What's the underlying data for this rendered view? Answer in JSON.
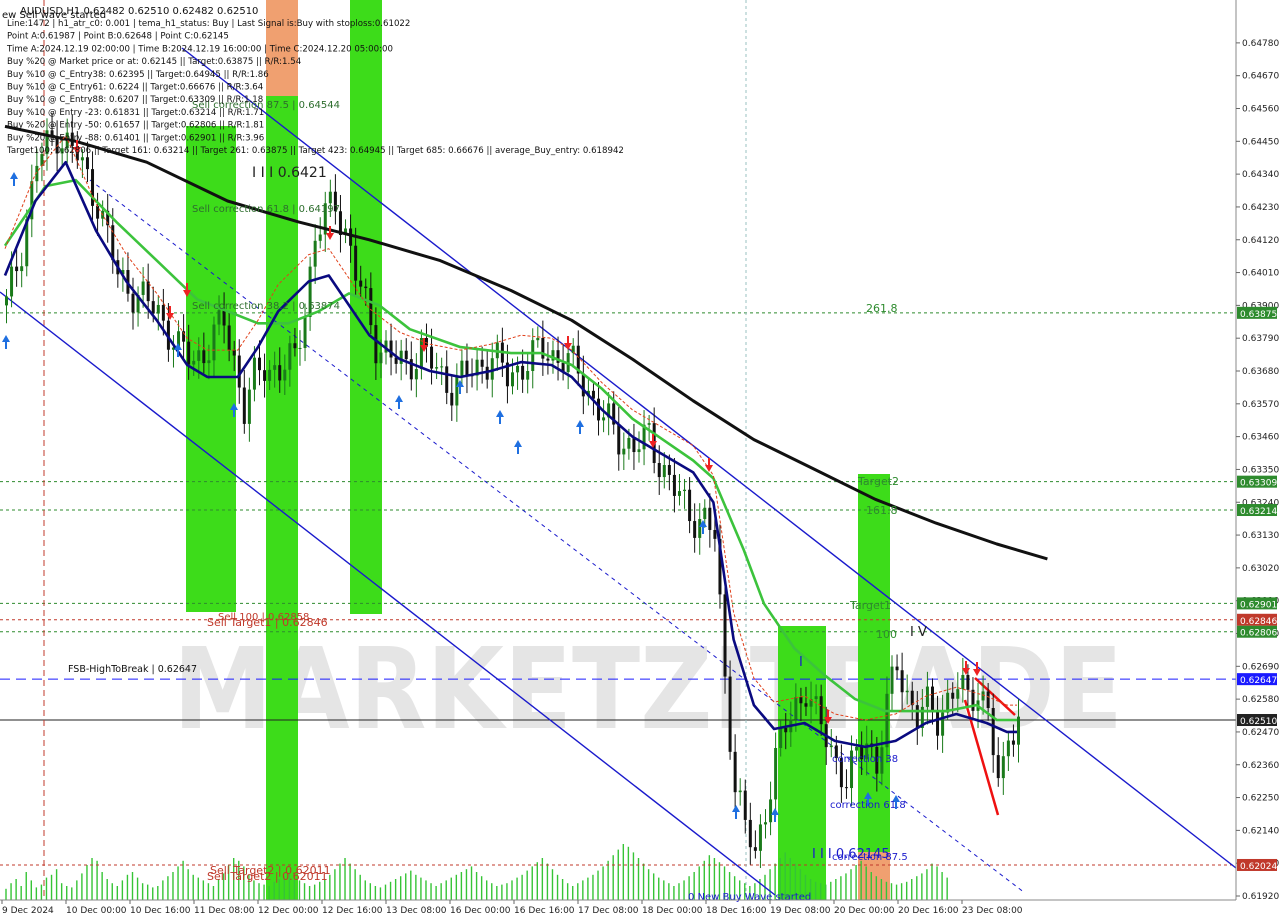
{
  "header": {
    "top_line": "AUDUSD,H1  0.62482 0.62510 0.62482 0.62510",
    "status_line": "ew Sell wave started",
    "info_lines": [
      "Line:1472  |  h1_atr_c0: 0.001  |  tema_h1_status: Buy  |  Last Signal is:Buy with stoploss:0.61022",
      "Point A:0.61987  |  Point B:0.62648  |  Point C:0.62145",
      "Time A:2024.12.19 02:00:00  |  Time B:2024.12.19 16:00:00  |  Time C:2024.12.20 05:00:00",
      "Buy %20 @ Market price or at: 0.62145  ||  Target:0.63875  ||  R/R:1.54",
      "Buy %10 @ C_Entry38: 0.62395  ||  Target:0.64945  ||  R/R:1.86",
      "Buy %10 @ C_Entry61: 0.6224  ||  Target:0.66676  ||  R/R:3.64",
      "Buy %10 @ C_Entry88: 0.6207  ||  Target:0.63309  ||  R/R:1.18",
      "Buy %10 @ Entry -23: 0.61831  ||  Target:0.63214  ||  R/R:1.71",
      "Buy %20 @ Entry -50: 0.61657  ||  Target:0.62806  ||  R/R:1.81",
      "Buy %20 @ Entry -88: 0.61401  ||  Target:0.62901  ||  R/R:3.96",
      "Target100: 0.62806  ||  Target 161: 0.63214  ||  Target 261: 0.63875  ||  Target 423: 0.64945  ||  Target 685: 0.66676  ||  average_Buy_entry: 0.618942"
    ]
  },
  "watermark": "MARKETZITRADE",
  "chart_data": {
    "type": "line",
    "title": "AUDUSD,H1",
    "ylim": [
      0.6192,
      0.6485
    ],
    "y_ticks": [
      "0.64780",
      "0.64670",
      "0.64560",
      "0.64450",
      "0.64340",
      "0.64230",
      "0.64120",
      "0.64010",
      "0.63900",
      "0.63790",
      "0.63680",
      "0.63570",
      "0.63460",
      "0.63350",
      "0.63240",
      "0.63130",
      "0.63020",
      "0.62910",
      "0.62800",
      "0.62690",
      "0.62580",
      "0.62470",
      "0.62360",
      "0.62250",
      "0.62140",
      "0.62030",
      "0.61920"
    ],
    "x_ticks": [
      "9 Dec 2024",
      "10 Dec 00:00",
      "10 Dec 16:00",
      "11 Dec 08:00",
      "12 Dec 00:00",
      "12 Dec 16:00",
      "13 Dec 08:00",
      "16 Dec 00:00",
      "16 Dec 16:00",
      "17 Dec 08:00",
      "18 Dec 00:00",
      "18 Dec 16:00",
      "19 Dec 08:00",
      "20 Dec 00:00",
      "20 Dec 16:00",
      "23 Dec 08:00"
    ],
    "close_series": {
      "name": "price",
      "points": [
        [
          0,
          0.639
        ],
        [
          3,
          0.641
        ],
        [
          6,
          0.6438
        ],
        [
          10,
          0.6448
        ],
        [
          14,
          0.644
        ],
        [
          18,
          0.6425
        ],
        [
          22,
          0.64
        ],
        [
          26,
          0.6393
        ],
        [
          30,
          0.6388
        ],
        [
          34,
          0.6375
        ],
        [
          37,
          0.6372
        ],
        [
          40,
          0.6376
        ],
        [
          43,
          0.6385
        ],
        [
          45,
          0.6372
        ],
        [
          47,
          0.6355
        ],
        [
          49,
          0.6365
        ],
        [
          51,
          0.637
        ],
        [
          54,
          0.6368
        ],
        [
          57,
          0.6372
        ],
        [
          59,
          0.639
        ],
        [
          61,
          0.6412
        ],
        [
          63,
          0.642
        ],
        [
          65,
          0.6425
        ],
        [
          67,
          0.6415
        ],
        [
          69,
          0.64
        ],
        [
          71,
          0.639
        ],
        [
          73,
          0.6378
        ],
        [
          76,
          0.6372
        ],
        [
          79,
          0.637
        ],
        [
          82,
          0.6375
        ],
        [
          85,
          0.6368
        ],
        [
          88,
          0.6363
        ],
        [
          92,
          0.6368
        ],
        [
          96,
          0.6373
        ],
        [
          99,
          0.6366
        ],
        [
          102,
          0.637
        ],
        [
          106,
          0.6375
        ],
        [
          110,
          0.6372
        ],
        [
          113,
          0.6368
        ],
        [
          116,
          0.6358
        ],
        [
          118,
          0.6352
        ],
        [
          121,
          0.6346
        ],
        [
          124,
          0.6342
        ],
        [
          127,
          0.6346
        ],
        [
          129,
          0.6338
        ],
        [
          132,
          0.6328
        ],
        [
          135,
          0.632
        ],
        [
          138,
          0.6318
        ],
        [
          140,
          0.6312
        ],
        [
          142,
          0.6265
        ],
        [
          144,
          0.623
        ],
        [
          146,
          0.6215
        ],
        [
          148,
          0.6205
        ],
        [
          150,
          0.6222
        ],
        [
          152,
          0.6238
        ],
        [
          154,
          0.6248
        ],
        [
          156,
          0.6256
        ],
        [
          158,
          0.6262
        ],
        [
          160,
          0.6252
        ],
        [
          162,
          0.6245
        ],
        [
          164,
          0.6238
        ],
        [
          166,
          0.623
        ],
        [
          168,
          0.6238
        ],
        [
          170,
          0.6245
        ],
        [
          172,
          0.6236
        ],
        [
          174,
          0.6255
        ],
        [
          176,
          0.627
        ],
        [
          178,
          0.626
        ],
        [
          180,
          0.6252
        ],
        [
          182,
          0.6255
        ],
        [
          184,
          0.6252
        ],
        [
          186,
          0.6258
        ],
        [
          188,
          0.6262
        ],
        [
          190,
          0.6258
        ],
        [
          192,
          0.6262
        ],
        [
          194,
          0.6254
        ],
        [
          196,
          0.6228
        ],
        [
          197,
          0.6234
        ],
        [
          198,
          0.6248
        ],
        [
          200,
          0.6251
        ]
      ]
    },
    "ema_green": {
      "name": "",
      "points": [
        [
          0,
          0.641
        ],
        [
          8,
          0.643
        ],
        [
          14,
          0.6432
        ],
        [
          22,
          0.6418
        ],
        [
          30,
          0.6405
        ],
        [
          38,
          0.6392
        ],
        [
          44,
          0.6388
        ],
        [
          50,
          0.6384
        ],
        [
          56,
          0.6384
        ],
        [
          62,
          0.6388
        ],
        [
          68,
          0.6394
        ],
        [
          74,
          0.639
        ],
        [
          80,
          0.6382
        ],
        [
          90,
          0.6376
        ],
        [
          100,
          0.6374
        ],
        [
          106,
          0.6374
        ],
        [
          112,
          0.637
        ],
        [
          118,
          0.6362
        ],
        [
          124,
          0.6352
        ],
        [
          130,
          0.6345
        ],
        [
          136,
          0.6338
        ],
        [
          140,
          0.6332
        ],
        [
          146,
          0.6308
        ],
        [
          150,
          0.629
        ],
        [
          156,
          0.6275
        ],
        [
          162,
          0.6266
        ],
        [
          168,
          0.6258
        ],
        [
          174,
          0.6254
        ],
        [
          180,
          0.6254
        ],
        [
          186,
          0.6254
        ],
        [
          192,
          0.6256
        ],
        [
          196,
          0.6251
        ],
        [
          200,
          0.6251
        ]
      ]
    },
    "ema_navy": {
      "name": "",
      "points": [
        [
          0,
          0.64
        ],
        [
          6,
          0.6425
        ],
        [
          12,
          0.6438
        ],
        [
          18,
          0.6415
        ],
        [
          24,
          0.6398
        ],
        [
          30,
          0.6385
        ],
        [
          36,
          0.637
        ],
        [
          40,
          0.6366
        ],
        [
          46,
          0.6366
        ],
        [
          50,
          0.6376
        ],
        [
          54,
          0.6388
        ],
        [
          60,
          0.6398
        ],
        [
          64,
          0.64
        ],
        [
          68,
          0.639
        ],
        [
          72,
          0.638
        ],
        [
          78,
          0.6372
        ],
        [
          84,
          0.6368
        ],
        [
          90,
          0.6366
        ],
        [
          96,
          0.6368
        ],
        [
          102,
          0.6371
        ],
        [
          108,
          0.637
        ],
        [
          112,
          0.6366
        ],
        [
          118,
          0.6355
        ],
        [
          124,
          0.6346
        ],
        [
          130,
          0.634
        ],
        [
          136,
          0.6334
        ],
        [
          140,
          0.6324
        ],
        [
          144,
          0.6278
        ],
        [
          148,
          0.6256
        ],
        [
          152,
          0.6248
        ],
        [
          158,
          0.625
        ],
        [
          164,
          0.6244
        ],
        [
          170,
          0.6242
        ],
        [
          176,
          0.6244
        ],
        [
          182,
          0.625
        ],
        [
          188,
          0.6253
        ],
        [
          194,
          0.625
        ],
        [
          198,
          0.6247
        ],
        [
          200,
          0.6247
        ]
      ]
    },
    "ma_black": {
      "name": "",
      "points": [
        [
          0,
          0.645
        ],
        [
          14,
          0.6445
        ],
        [
          28,
          0.6438
        ],
        [
          44,
          0.6425
        ],
        [
          58,
          0.6418
        ],
        [
          72,
          0.6412
        ],
        [
          86,
          0.6405
        ],
        [
          100,
          0.6395
        ],
        [
          112,
          0.6385
        ],
        [
          124,
          0.6372
        ],
        [
          136,
          0.6358
        ],
        [
          148,
          0.6345
        ],
        [
          160,
          0.6335
        ],
        [
          172,
          0.6325
        ],
        [
          184,
          0.6317
        ],
        [
          196,
          0.631
        ],
        [
          206,
          0.6305
        ]
      ]
    },
    "volume": [
      8,
      12,
      15,
      10,
      20,
      14,
      9,
      11,
      16,
      18,
      22,
      12,
      10,
      9,
      14,
      19,
      25,
      30,
      28,
      20,
      15,
      12,
      10,
      14,
      18,
      20,
      16,
      12,
      11,
      9,
      10,
      14,
      17,
      20,
      24,
      28,
      22,
      18,
      16,
      14,
      12,
      10,
      15,
      19,
      25,
      30,
      28,
      24,
      18,
      14,
      12,
      11,
      10,
      13,
      15,
      17,
      19,
      16,
      14,
      12,
      10,
      11,
      13,
      15,
      18,
      22,
      26,
      30,
      26,
      22,
      18,
      14,
      12,
      10,
      9,
      11,
      13,
      15,
      17,
      19,
      21,
      18,
      16,
      14,
      12,
      10,
      12,
      14,
      16,
      18,
      20,
      22,
      24,
      20,
      17,
      14,
      12,
      10,
      11,
      12,
      14,
      16,
      18,
      21,
      24,
      27,
      30,
      26,
      22,
      18,
      15,
      12,
      10,
      12,
      14,
      16,
      18,
      21,
      24,
      28,
      32,
      36,
      40,
      38,
      34,
      30,
      26,
      22,
      19,
      16,
      14,
      12,
      10,
      12,
      14,
      17,
      20,
      24,
      28,
      32,
      30,
      27,
      24,
      20,
      17,
      14,
      12,
      10,
      12,
      15,
      18,
      22,
      26,
      30,
      34,
      30,
      26,
      22,
      18,
      15,
      13,
      12,
      11,
      13,
      15,
      17,
      19,
      22,
      25,
      28,
      24,
      20,
      17,
      15,
      13,
      12,
      11,
      12,
      13,
      15,
      17,
      19,
      22,
      26,
      24,
      20,
      16
    ]
  },
  "levels": [
    {
      "label": "0.63875",
      "color": "#2e8b2e"
    },
    {
      "label": "0.63309",
      "color": "#2e8b2e"
    },
    {
      "label": "0.63214",
      "color": "#2e8b2e"
    },
    {
      "label": "0.62901",
      "color": "#2e8b2e"
    },
    {
      "label": "0.62846",
      "color": "#c0392b"
    },
    {
      "label": "0.62806",
      "color": "#2e8b2e"
    },
    {
      "label": "0.62647",
      "color": "#1a1aff"
    },
    {
      "label": "0.62510",
      "color": "#222222"
    },
    {
      "label": "0.62024",
      "color": "#c0392b"
    }
  ],
  "annotations": {
    "fsb": "FSB-HighToBreak  |  0.62647",
    "wave_top": "I I I 0.6421",
    "wave_low": "I I I 0.62145",
    "sell_corr_61": "Sell correction 61.8 | 0.64197",
    "sell_corr_38": "Sell correction 38.2 | 0.63874",
    "sell_corr_87": "Sell correction 87.5 | 0.64544",
    "sell_100": "Sell 100 | 0.62858",
    "sell_target1": "Sell Target1 | 0.62846",
    "sell_target2": "Sell Target2 | 0.62011",
    "sell_target2b": "Sell Target2 | 0.62011",
    "fib_261": "261.8",
    "fib_161": "161.8",
    "fib_100": "100",
    "target1": "Target1",
    "target2": "Target2",
    "wave_iv": "I V",
    "wave_i_mark": "I",
    "corr_38": "correction 38",
    "corr_61": "correction 61.8",
    "corr_87": "correction 87.5",
    "new_buy": "0 New Buy Wave started"
  },
  "colors": {
    "bull": "#1a7a1a",
    "bear": "#111111",
    "green_bar": "#3ddc1a",
    "orange_bar": "#f0a070",
    "navy": "#0a0a80",
    "ema_green": "#3cc33c",
    "channel": "#1a1acc",
    "red_dash": "#e0401a"
  }
}
